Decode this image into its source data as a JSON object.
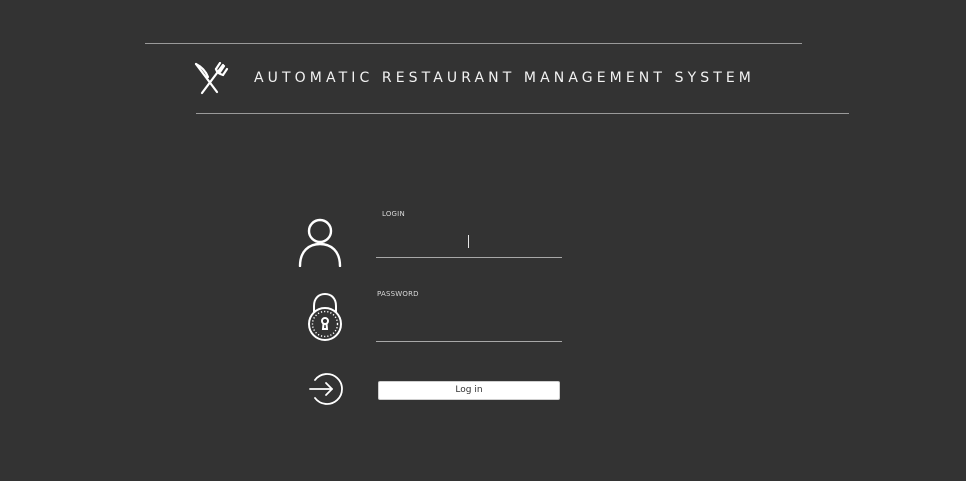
{
  "header": {
    "title": "AUTOMATIC RESTAURANT MANAGEMENT SYSTEM",
    "logo_icon": "fork-knife-crossed-icon"
  },
  "login_form": {
    "login_label": "LOGIN",
    "login_value": "",
    "password_label": "PASSWORD",
    "password_value": "",
    "submit_label": "Log in",
    "icons": {
      "user": "user-icon",
      "password": "lock-icon",
      "submit": "login-arrow-icon"
    }
  },
  "colors": {
    "background": "#333333",
    "foreground": "#f2f2f2",
    "rule": "#9a9a9a",
    "button": "#ffffff"
  }
}
